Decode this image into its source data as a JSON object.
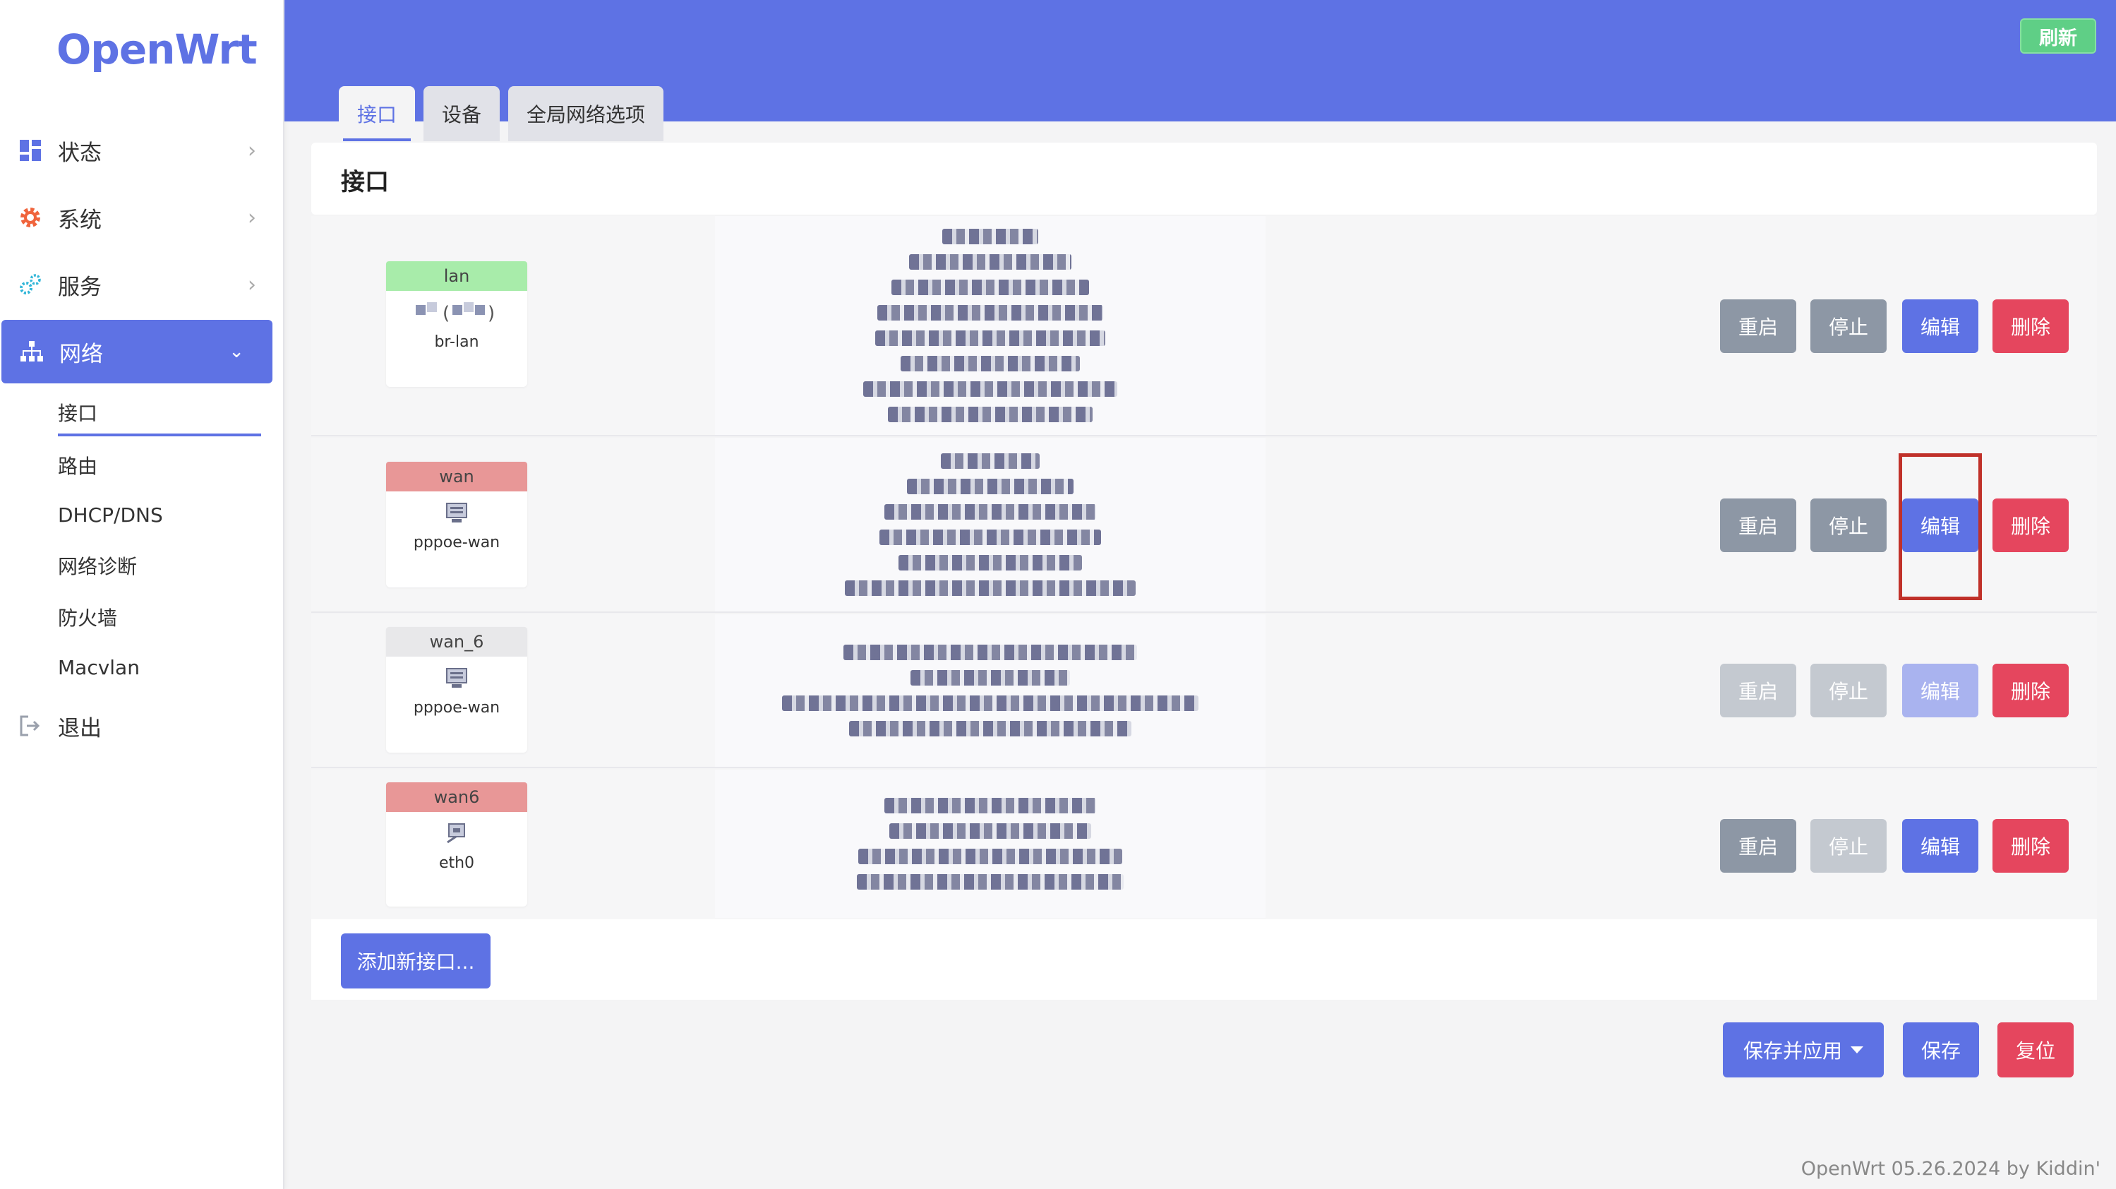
{
  "app": {
    "logo_text": "OpenWrt",
    "refresh_label": "刷新",
    "footer_text": "OpenWrt 05.26.2024 by Kiddin'"
  },
  "sidebar": {
    "items": [
      {
        "label": "状态",
        "icon": "dashboard-icon"
      },
      {
        "label": "系统",
        "icon": "gear-icon"
      },
      {
        "label": "服务",
        "icon": "cogs-icon"
      },
      {
        "label": "网络",
        "icon": "network-icon"
      },
      {
        "label": "退出",
        "icon": "logout-icon"
      }
    ],
    "network_sub": [
      {
        "label": "接口"
      },
      {
        "label": "路由"
      },
      {
        "label": "DHCP/DNS"
      },
      {
        "label": "网络诊断"
      },
      {
        "label": "防火墙"
      },
      {
        "label": "Macvlan"
      }
    ]
  },
  "tabs": [
    {
      "label": "接口"
    },
    {
      "label": "设备"
    },
    {
      "label": "全局网络选项"
    }
  ],
  "section": {
    "title": "接口"
  },
  "interfaces": [
    {
      "name": "lan",
      "device": "br-lan",
      "name_color": "#a8ecaa",
      "icon": "bridge-icon"
    },
    {
      "name": "wan",
      "device": "pppoe-wan",
      "name_color": "#e89797",
      "icon": "ppp-icon"
    },
    {
      "name": "wan_6",
      "device": "pppoe-wan",
      "name_color": "#e8e8ea",
      "icon": "ppp-icon"
    },
    {
      "name": "wan6",
      "device": "eth0",
      "name_color": "#e89797",
      "icon": "ethernet-icon"
    }
  ],
  "row_buttons": {
    "restart": "重启",
    "stop": "停止",
    "edit": "编辑",
    "delete": "删除"
  },
  "actions": {
    "add_interface": "添加新接口...",
    "save_apply": "保存并应用",
    "save": "保存",
    "reset": "复位"
  },
  "colors": {
    "accent": "#5e72e4",
    "danger": "#e5465e",
    "success": "#5fcf86",
    "neutral": "#8d97a5"
  }
}
